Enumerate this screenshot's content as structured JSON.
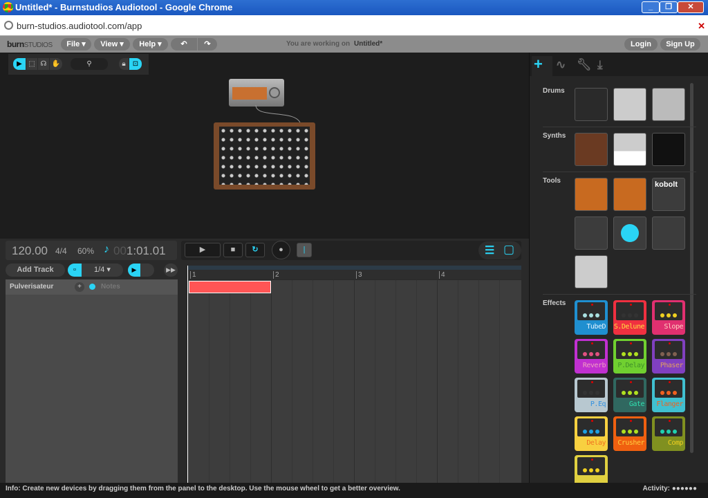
{
  "window": {
    "title": "Untitled* - Burnstudios Audiotool - Google Chrome",
    "url": "burn-studios.audiotool.com/app"
  },
  "menubar": {
    "brand": "burn",
    "brand2": "STUDIOS",
    "file": "File ▾",
    "view": "View ▾",
    "help": "Help ▾",
    "undo": "↶",
    "redo": "↷",
    "working_on": "You are working on",
    "project": "Untitled*",
    "login": "Login",
    "signup": "Sign Up"
  },
  "panel": {
    "tabs": [
      "add-icon",
      "waveform-icon",
      "wrench-icon",
      "download-icon"
    ],
    "categories": {
      "drums": "Drums",
      "synths": "Synths",
      "tools": "Tools",
      "effects": "Effects"
    },
    "tools": {
      "kobolt": "kobolt"
    },
    "effects": [
      {
        "name": "TubeD",
        "body": "#1f8fd0",
        "text": "#e6f4ff",
        "knob": "#a9e0e0"
      },
      {
        "name": "S.Delune",
        "body": "#f03040",
        "text": "#ffe040",
        "knob": "#333"
      },
      {
        "name": "Slope",
        "body": "#e03070",
        "text": "#ffd0c0",
        "knob": "#f0d020"
      },
      {
        "name": "Reverb",
        "body": "#c030d0",
        "text": "#f0a0c0",
        "knob": "#e05080"
      },
      {
        "name": "P.Delay",
        "body": "#70d030",
        "text": "#40902a",
        "knob": "#b0e020"
      },
      {
        "name": "Phaser",
        "body": "#8040c0",
        "text": "#e0a060",
        "knob": "#806050"
      },
      {
        "name": "P.Eq",
        "body": "#b8c8d0",
        "text": "#3090e0",
        "knob": "#333"
      },
      {
        "name": "Gate",
        "body": "#306860",
        "text": "#30e0b0",
        "knob": "#b0e020"
      },
      {
        "name": "Flanger",
        "body": "#40c0d0",
        "text": "#f06020",
        "knob": "#f06020"
      },
      {
        "name": "Delay",
        "body": "#f8d040",
        "text": "#f07020",
        "knob": "#20a0e0"
      },
      {
        "name": "Crusher",
        "body": "#f06010",
        "text": "#ffd040",
        "knob": "#b0e020"
      },
      {
        "name": "Comp",
        "body": "#809020",
        "text": "#f0d020",
        "knob": "#20d0b0"
      },
      {
        "name": "",
        "body": "#e0d040",
        "text": "#000",
        "knob": "#f0d020"
      }
    ]
  },
  "transport": {
    "bpm": "120.00",
    "signature": "4/4",
    "zoom": "60%",
    "position_dim": "00",
    "position": "1:01.01"
  },
  "timeline": {
    "add_track": "Add Track",
    "snap": "1/4 ▾",
    "bars": [
      "1",
      "2",
      "3",
      "4"
    ],
    "track_name": "Pulverisateur",
    "track_add": "+",
    "notes": "Notes"
  },
  "status": {
    "info": "Info: Create new devices by dragging them from the panel to the desktop. Use the mouse wheel to get a better overview.",
    "activity": "Activity: ●●●●●●"
  },
  "colors": {
    "accent": "#2ad4f5",
    "region": "#ff5555"
  }
}
